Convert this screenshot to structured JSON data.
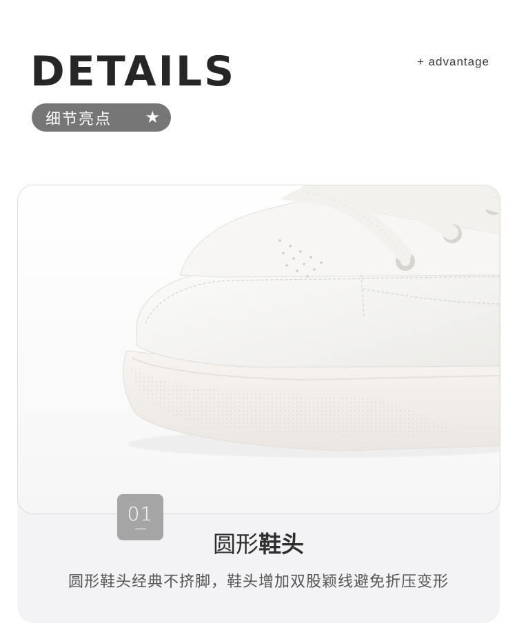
{
  "header": {
    "title": "DETAILS",
    "subtitle": "+ advantage",
    "pill_label": "细节亮点",
    "pill_icon": "star-icon",
    "pill_star_glyph": "★"
  },
  "photo": {
    "subject": "shoe-toe-closeup"
  },
  "feature": {
    "number": "01",
    "title_light": "圆形",
    "title_bold": "鞋头",
    "description": "圆形鞋头经典不挤脚，鞋头增加双股颖线避免折压变形"
  },
  "colors": {
    "pill_bg": "#767676",
    "badge_bg": "#a5a5a5",
    "card_bg": "#f3f3f5",
    "title_color": "#262626"
  }
}
